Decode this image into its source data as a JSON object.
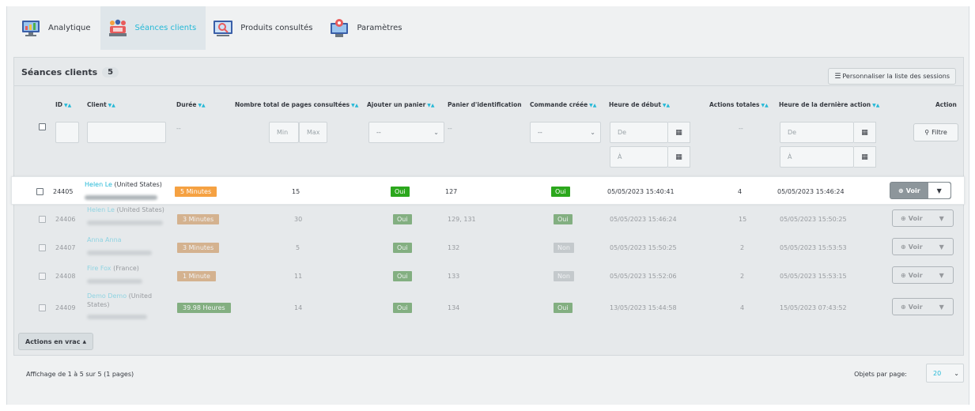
{
  "tabs": [
    {
      "label": "Analytique",
      "icon": "analytics-monitor-icon"
    },
    {
      "label": "Séances clients",
      "icon": "customer-sessions-icon"
    },
    {
      "label": "Produits consultés",
      "icon": "viewed-products-icon"
    },
    {
      "label": "Paramètres",
      "icon": "settings-computer-icon"
    }
  ],
  "panel": {
    "title": "Séances clients",
    "count": "5",
    "customize_label": "Personnaliser la liste des sessions"
  },
  "columns": {
    "id": "ID",
    "client": "Client",
    "duration": "Durée",
    "pages": "Nombre total de pages consultées",
    "cart": "Ajouter un panier",
    "cart_ids": "Panier d'identification",
    "order": "Commande créée",
    "start": "Heure de début",
    "actions": "Actions totales",
    "last": "Heure de la dernière action",
    "action": "Action"
  },
  "filters": {
    "dash": "--",
    "min": "Min",
    "max": "Max",
    "select_default": "--",
    "from": "De",
    "to": "À",
    "filter_label": "Filtre"
  },
  "rows": [
    {
      "id": "24405",
      "name": "Helen Le",
      "country": "(United States)",
      "duration": "5 Minutes",
      "pages": "15",
      "cart": "Oui",
      "cart_ids": "127",
      "order": "Oui",
      "start": "05/05/2023 15:40:41",
      "actions": "4",
      "last": "05/05/2023 15:46:24"
    },
    {
      "id": "24406",
      "name": "Helen Le",
      "country": "(United States)",
      "duration": "3 Minutes",
      "pages": "30",
      "cart": "Oui",
      "cart_ids": "129, 131",
      "order": "Oui",
      "start": "05/05/2023 15:46:24",
      "actions": "15",
      "last": "05/05/2023 15:50:25"
    },
    {
      "id": "24407",
      "name": "Anna Anna",
      "country": "",
      "duration": "3 Minutes",
      "pages": "5",
      "cart": "Oui",
      "cart_ids": "132",
      "order": "Non",
      "start": "05/05/2023 15:50:25",
      "actions": "2",
      "last": "05/05/2023 15:53:53"
    },
    {
      "id": "24408",
      "name": "Fire Fox",
      "country": "(France)",
      "duration": "1 Minute",
      "pages": "11",
      "cart": "Oui",
      "cart_ids": "133",
      "order": "Non",
      "start": "05/05/2023 15:52:06",
      "actions": "2",
      "last": "05/05/2023 15:53:15"
    },
    {
      "id": "24409",
      "name": "Demo Demo",
      "country": "(United",
      "country2": "States)",
      "duration": "39.98 Heures",
      "pages": "14",
      "cart": "Oui",
      "cart_ids": "134",
      "order": "Oui",
      "start": "13/05/2023 15:44:58",
      "actions": "4",
      "last": "15/05/2023 07:43:52"
    }
  ],
  "voir_label": "Voir",
  "bulk_label": "Actions en vrac",
  "pagination": {
    "info": "Affichage de 1 à 5 sur 5 (1 pages)",
    "per_page_label": "Objets par page:",
    "per_page_value": "20"
  },
  "colors": {
    "accent": "#25b9d7",
    "orange": "#f5a142",
    "green": "#2ba71c",
    "gray": "#8d969b"
  }
}
